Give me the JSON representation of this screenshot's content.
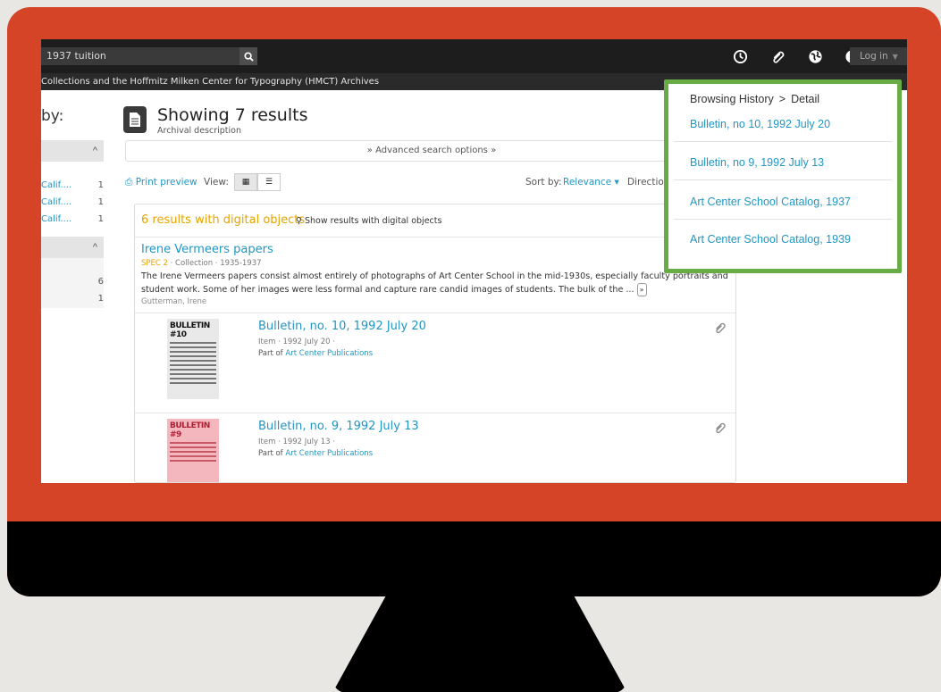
{
  "topbar": {
    "search_value": "1937 tuition",
    "login_label": "Log in"
  },
  "subbar": {
    "text": "Collections and the Hoffmitz Milken Center for Typography (HMCT) Archives"
  },
  "sidebar": {
    "heading": "by:",
    "facets_a": [
      {
        "label": "Calif....",
        "count": "1"
      },
      {
        "label": "Calif....",
        "count": "1"
      },
      {
        "label": "Calif....",
        "count": "1"
      }
    ],
    "facets_b": [
      {
        "count": "6"
      },
      {
        "count": "1"
      }
    ]
  },
  "main": {
    "title": "Showing 7 results",
    "subtitle": "Archival description",
    "advanced_search": "Advanced search options",
    "print_preview": "Print preview",
    "view_label": "View:",
    "sort_label": "Sort by:",
    "sort_value": "Relevance",
    "direction_label": "Direction:",
    "digital_heading": "6 results with digital objects",
    "digital_link": "Show results with digital objects"
  },
  "records": [
    {
      "title": "Irene Vermeers papers",
      "ref": "SPEC 2",
      "meta": " · Collection · 1935-1937",
      "description": "The Irene Vermeers papers consist almost entirely of photographs of Art Center School in the mid-1930s, especially faculty portraits and student work. Some of her images were less formal and capture rare candid images of students. The bulk of the ...",
      "more": "»",
      "creator": "Gutterman, Irene"
    },
    {
      "title": "Bulletin, no. 10, 1992 July 20",
      "meta": "Item · 1992 July 20 ·",
      "part_of_prefix": "Part of",
      "part_of": "Art Center Publications",
      "thumb_text": "BULLETIN",
      "thumb_num": "#10"
    },
    {
      "title": "Bulletin, no. 9, 1992 July 13",
      "meta": "Item · 1992 July 13 ·",
      "part_of_prefix": "Part of",
      "part_of": "Art Center Publications",
      "thumb_text": "BULLETIN",
      "thumb_num": "#9"
    }
  ],
  "popover": {
    "crumb_root": "Browsing History",
    "crumb_sep": ">",
    "crumb_current": "Detail",
    "items": [
      "Bulletin, no 10, 1992 July 20",
      "Bulletin, no 9, 1992 July 13",
      "Art Center School Catalog, 1937",
      "Art Center School Catalog, 1939"
    ]
  },
  "icons": {
    "topbar": [
      "search-icon",
      "clock-icon",
      "clip-icon",
      "globe-icon",
      "info-icon"
    ],
    "toolbar": [
      "print-icon",
      "grid-view-icon",
      "list-view-icon",
      "caret-down-icon"
    ],
    "results": [
      "search-icon",
      "paperclip-icon"
    ],
    "popover_accent": "#67ac45",
    "link_color": "#2196c4",
    "highlight_color": "#e8a300",
    "frame_color": "#d54426"
  }
}
